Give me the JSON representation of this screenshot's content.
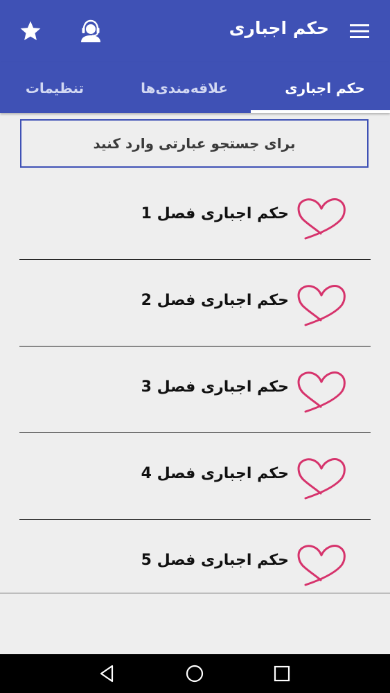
{
  "app_bar": {
    "title": "حکم اجباری",
    "icons": [
      "menu-icon",
      "support-agent-icon",
      "star-icon"
    ],
    "background_color": "#3f51b5"
  },
  "tabs": [
    {
      "label": "حکم اجباری",
      "active": true
    },
    {
      "label": "علاقه‌مندی‌ها",
      "active": false
    },
    {
      "label": "تنظیمات",
      "active": false
    }
  ],
  "search": {
    "placeholder": "برای جستجو عبارتی وارد کنید",
    "value": ""
  },
  "list": {
    "items": [
      {
        "label": "حکم اجباری فصل 1",
        "icon": "heart-outline-icon"
      },
      {
        "label": "حکم اجباری فصل 2",
        "icon": "heart-outline-icon"
      },
      {
        "label": "حکم اجباری فصل 3",
        "icon": "heart-outline-icon"
      },
      {
        "label": "حکم اجباری فصل 4",
        "icon": "heart-outline-icon"
      },
      {
        "label": "حکم اجباری فصل 5",
        "icon": "heart-outline-icon"
      }
    ],
    "heart_color": "#d6336c"
  },
  "system_nav": {
    "buttons": [
      "back-icon",
      "home-icon",
      "recents-icon"
    ]
  }
}
